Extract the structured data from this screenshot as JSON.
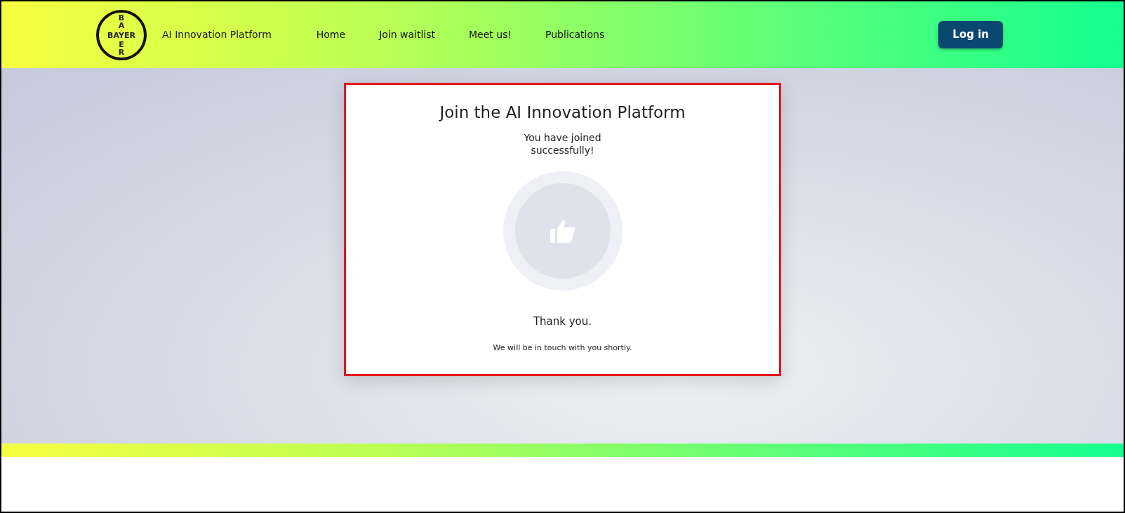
{
  "header": {
    "logo": {
      "horizontal": "BAYER",
      "vertical_top": "BA",
      "vertical_bottom": "ER"
    },
    "brand": "AI Innovation Platform",
    "nav": [
      {
        "label": "Home"
      },
      {
        "label": "Join waitlist"
      },
      {
        "label": "Meet us!"
      },
      {
        "label": "Publications"
      }
    ],
    "login_button": "Log in"
  },
  "card": {
    "title": "Join the AI Innovation Platform",
    "message": "You have joined successfully!",
    "thanks": "Thank you.",
    "note": "We will be in touch with you shortly."
  }
}
